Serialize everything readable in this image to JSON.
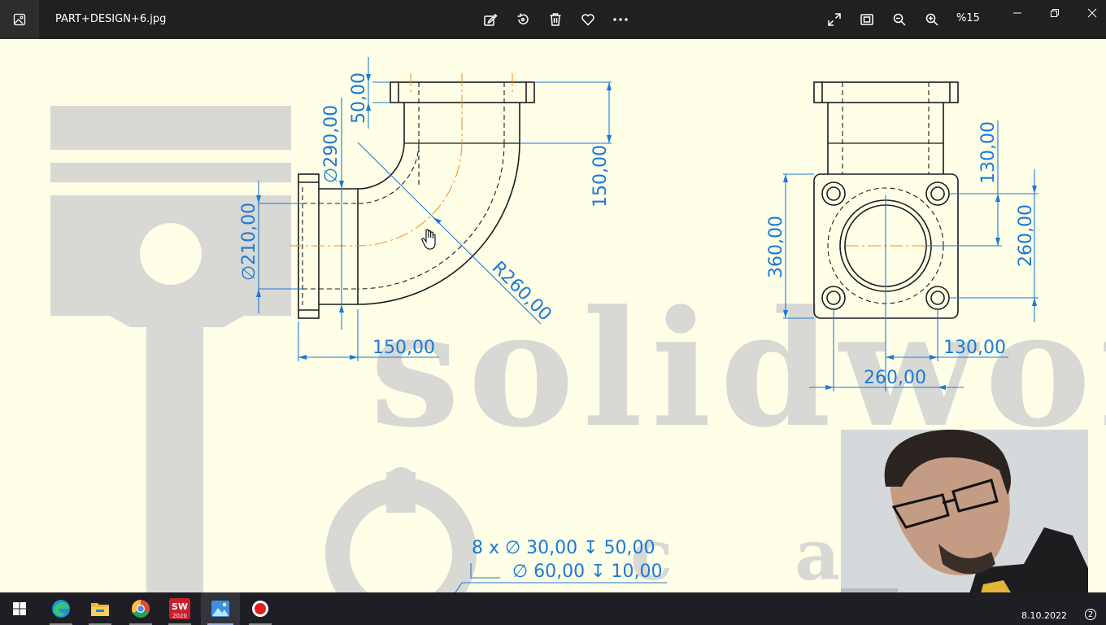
{
  "titlebar": {
    "file_name": "PART+DESIGN+6.jpg",
    "zoom_level": "%15",
    "icons": [
      "edit-icon",
      "rotate-icon",
      "delete-icon",
      "favorite-icon",
      "more-icon",
      "fullscreen-icon",
      "fit-icon",
      "zoom-out-icon",
      "zoom-in-icon"
    ]
  },
  "drawing": {
    "watermark": "solidworks",
    "watermark_2": "c a",
    "side_view": {
      "dims": {
        "flange_thickness": "50,00",
        "pipe_diameter": "∅290,00",
        "bore_diameter": "∅210,00",
        "height": "150,00",
        "radius": "R260,00",
        "width": "150,00"
      }
    },
    "front_view": {
      "dims": {
        "vertical_130": "130,00",
        "vertical_260": "260,00",
        "height_360": "360,00",
        "horizontal_130": "130,00",
        "horizontal_260": "260,00"
      }
    },
    "hole_note": {
      "line1": "8 x  ∅  30,00  ↧  50,00",
      "line2": "∅  60,00  ↧  10,00"
    }
  },
  "taskbar": {
    "apps": [
      "start-icon",
      "edge-icon",
      "file-explorer-icon",
      "chrome-icon",
      "solidworks-icon",
      "photos-icon",
      "record-icon"
    ],
    "sw_label": "2020",
    "date": "8.10.2022",
    "notification_count": "2"
  },
  "colors": {
    "dimension": "#1a7ad8",
    "centerline": "#f08a1c",
    "canvas": "#ffffe8",
    "watermark": "#d8d8d4"
  }
}
